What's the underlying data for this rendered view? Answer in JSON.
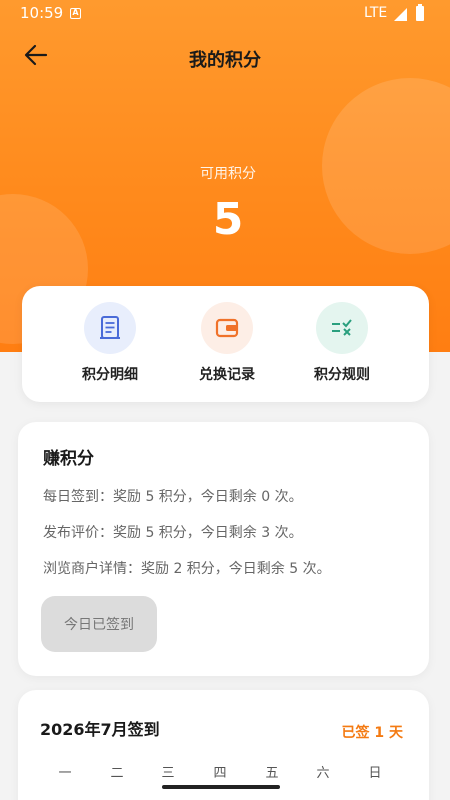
{
  "status_bar": {
    "time": "10:59",
    "notification_badge": "A",
    "network": "LTE"
  },
  "header": {
    "title": "我的积分",
    "points_label": "可用积分",
    "points_value": "5"
  },
  "actions": [
    {
      "label": "积分明细",
      "icon": "receipt-icon",
      "circle_color": "#e8eefc",
      "icon_color": "#4a6bd8"
    },
    {
      "label": "兑换记录",
      "icon": "wallet-icon",
      "circle_color": "#fdeee6",
      "icon_color": "#f0722a"
    },
    {
      "label": "积分规则",
      "icon": "rules-check-icon",
      "circle_color": "#e4f5ef",
      "icon_color": "#2a9f7e"
    }
  ],
  "earn": {
    "title": "赚积分",
    "lines": [
      "每日签到：奖励 5 积分，今日剩余 0 次。",
      "发布评价：奖励 5 积分，今日剩余 3 次。",
      "浏览商户详情：奖励 2 积分，今日剩余 5 次。"
    ],
    "checkin_button": "今日已签到"
  },
  "calendar": {
    "title": "2026年7月签到",
    "signed_summary": "已签 1 天",
    "weekdays": [
      "一",
      "二",
      "三",
      "四",
      "五",
      "六",
      "日"
    ]
  },
  "colors": {
    "accent": "#ff8a1c",
    "signed_text": "#f47a12"
  }
}
